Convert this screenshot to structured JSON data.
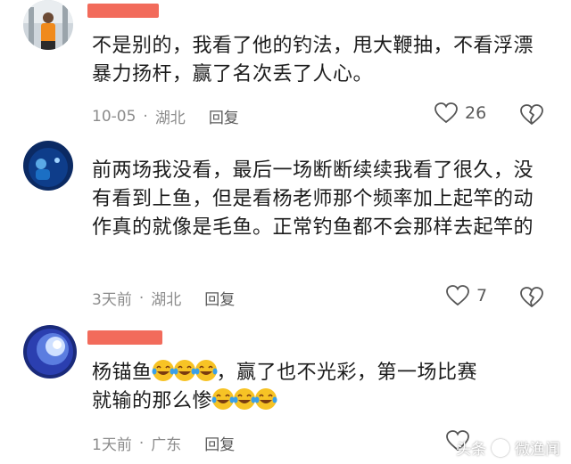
{
  "comments": [
    {
      "text": "不是别的，我看了他的钓法，甩大鞭抽，不看浮漂暴力扬杆，赢了名次丢了人心。",
      "time": "10-05",
      "location": "湖北",
      "reply": "回复",
      "likes": "26"
    },
    {
      "text": "前两场我没看，最后一场断断续续我看了很久，没有看到上鱼，但是看杨老师那个频率加上起竿的动作真的就像是毛鱼。正常钓鱼都不会那样去起竿的",
      "time": "3天前",
      "location": "湖北",
      "reply": "回复",
      "likes": "7"
    },
    {
      "text_a": "杨锚鱼",
      "text_b": "，赢了也不光彩，第一场比赛",
      "text_c": "就输的那么惨",
      "time": "1天前",
      "location": "广东",
      "reply": "回复"
    }
  ],
  "watermark": {
    "left": "头条",
    "right": "微渔闻"
  },
  "colors": {
    "name_bar": "#f26b5b",
    "meta": "#8c8c8c",
    "text": "#1c1c1c",
    "emoji_face": "#f7c325"
  }
}
